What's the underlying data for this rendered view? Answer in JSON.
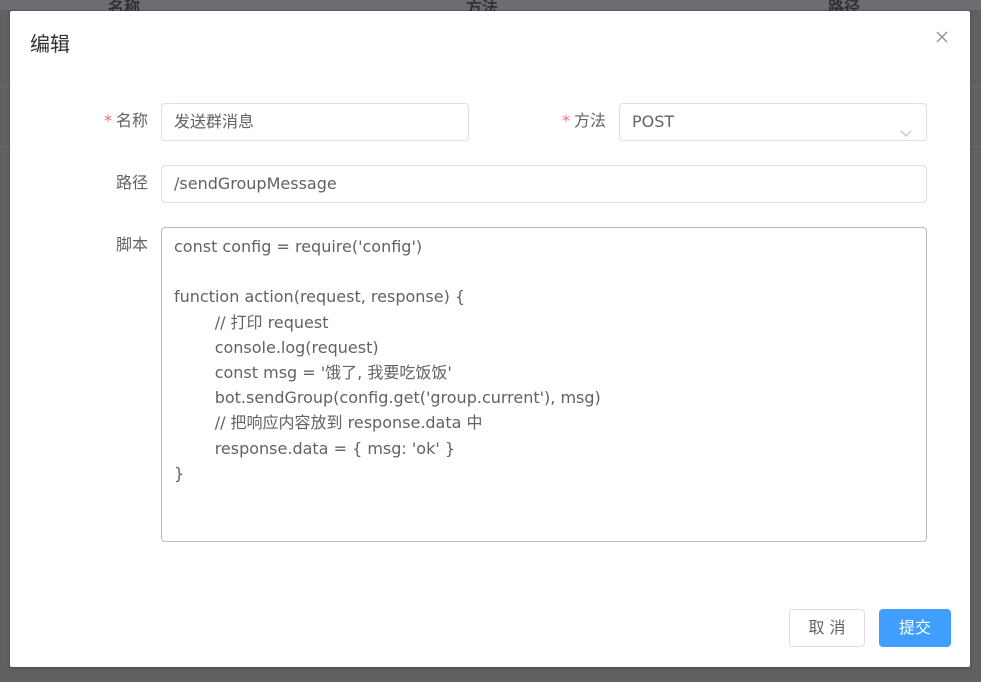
{
  "background": {
    "columns": [
      "名称",
      "方法",
      "路径"
    ]
  },
  "dialog": {
    "title": "编辑",
    "close_icon": "close-icon"
  },
  "form": {
    "name": {
      "label": "名称",
      "required": true,
      "value": "发送群消息"
    },
    "method": {
      "label": "方法",
      "required": true,
      "value": "POST",
      "icon": "chevron-down-icon"
    },
    "path": {
      "label": "路径",
      "value": "/sendGroupMessage"
    },
    "script": {
      "label": "脚本",
      "lines": [
        "const config = require('config')",
        "",
        "function action(request, response) {",
        "        // 打印 request",
        "        console.log(request)",
        "        const msg = '饿了, 我要吃饭饭'",
        "        bot.sendGroup(config.get('group.current'), msg)",
        "        // 把响应内容放到 response.data 中",
        "        response.data = { msg: 'ok' }",
        "}"
      ]
    }
  },
  "footer": {
    "cancel_label": "取 消",
    "submit_label": "提交"
  },
  "colors": {
    "primary": "#409eff",
    "required": "#f56c6c",
    "text": "#606266",
    "title": "#303133",
    "overlay": "#5f6163"
  }
}
